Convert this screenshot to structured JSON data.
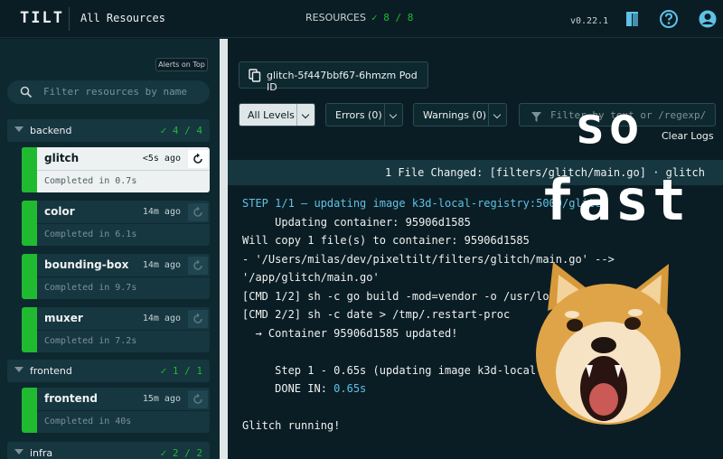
{
  "header": {
    "logo": "TILT",
    "nav_label": "All Resources",
    "resources_label": "RESOURCES",
    "resources_count": "✓ 8 / 8",
    "version": "v0.22.1",
    "icons": [
      "book-icon",
      "help-icon",
      "account-icon"
    ]
  },
  "sidebar": {
    "alerts_button": "Alerts on Top",
    "search_placeholder": "Filter resources by name",
    "groups": [
      {
        "name": "backend",
        "count": "✓ 4 / 4"
      },
      {
        "name": "frontend",
        "count": "✓ 1 / 1"
      },
      {
        "name": "infra",
        "count": "✓ 2 / 2"
      }
    ],
    "resources": [
      {
        "name": "glitch",
        "ago": "<5s ago",
        "status": "Completed in 0.7s"
      },
      {
        "name": "color",
        "ago": "14m ago",
        "status": "Completed in 6.1s"
      },
      {
        "name": "bounding-box",
        "ago": "14m ago",
        "status": "Completed in 9.7s"
      },
      {
        "name": "muxer",
        "ago": "14m ago",
        "status": "Completed in 7.2s"
      },
      {
        "name": "frontend",
        "ago": "15m ago",
        "status": "Completed in 40s"
      }
    ]
  },
  "main": {
    "pod_id": "glitch-5f447bbf67-6hmzm Pod ID",
    "filters": {
      "levels": "All Levels",
      "errors": "Errors (0)",
      "warnings": "Warnings (0)",
      "search_placeholder": "Filter by text or /regexp/"
    },
    "clear_logs": "Clear Logs",
    "banner": "1 File Changed: [filters/glitch/main.go] · glitch",
    "log": [
      "STEP 1/1 — updating image k3d-local-registry:5000/glitch",
      "     Updating container: 95906d1585",
      "Will copy 1 file(s) to container: 95906d1585",
      "- '/Users/milas/dev/pixeltilt/filters/glitch/main.go' -->",
      "'/app/glitch/main.go'",
      "[CMD 1/2] sh -c go build -mod=vendor -o /usr/local/bin/glitch",
      "[CMD 2/2] sh -c date > /tmp/.restart-proc",
      "  → Container 95906d1585 updated!",
      "",
      "     Step 1 - 0.65s (updating image k3d-local-registry...)",
      "     DONE IN: ",
      "",
      "Glitch running!"
    ],
    "done_time": "0.65s"
  },
  "overlay": {
    "word1": "so",
    "word2": "fast",
    "image": "shiba-doge"
  },
  "colors": {
    "bg": "#0b1d24",
    "sidebar": "#0e2830",
    "accent_green": "#20ba31",
    "link_blue": "#5ec2e6"
  }
}
